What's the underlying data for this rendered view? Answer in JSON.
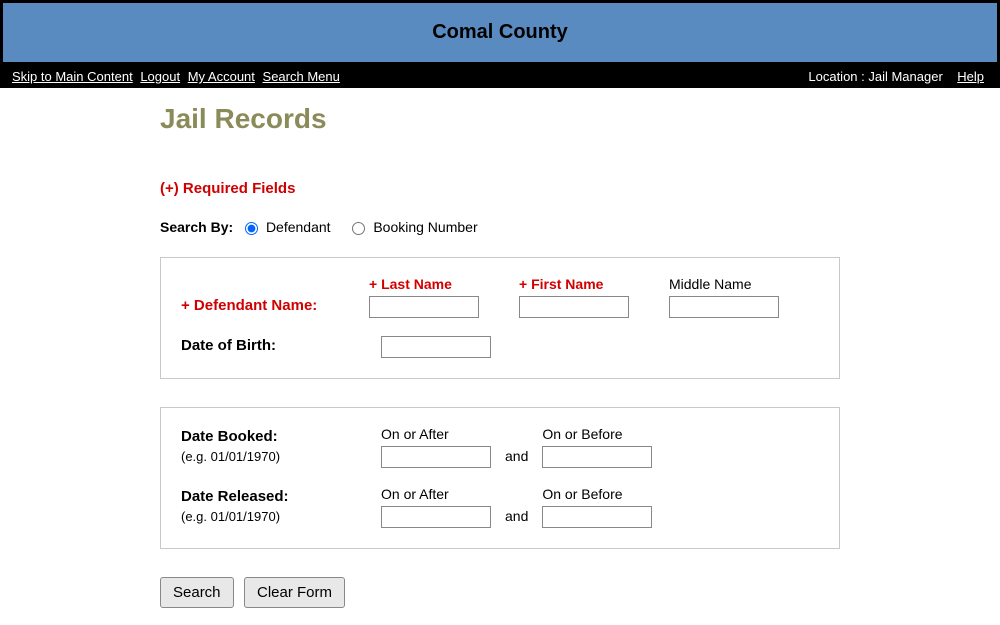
{
  "header": {
    "title": "Comal County"
  },
  "nav": {
    "links": {
      "skip": "Skip to Main Content",
      "logout": "Logout",
      "account": "My Account",
      "search_menu": "Search Menu"
    },
    "location_label": "Location : Jail Manager",
    "help": "Help"
  },
  "page": {
    "title": "Jail Records",
    "required_note": "(+) Required Fields",
    "search_by_label": "Search By:",
    "search_by_options": {
      "defendant": "Defendant",
      "booking": "Booking Number"
    },
    "defendant_box": {
      "name_label": "+ Defendant Name:",
      "last_name_label": "+ Last Name",
      "first_name_label": "+ First Name",
      "middle_name_label": "Middle Name",
      "dob_label": "Date of Birth:"
    },
    "date_box": {
      "booked_label": "Date Booked:",
      "released_label": "Date Released:",
      "hint": "(e.g. 01/01/1970)",
      "on_after": "On or After",
      "on_before": "On or Before",
      "and": "and"
    },
    "buttons": {
      "search": "Search",
      "clear": "Clear Form"
    }
  }
}
